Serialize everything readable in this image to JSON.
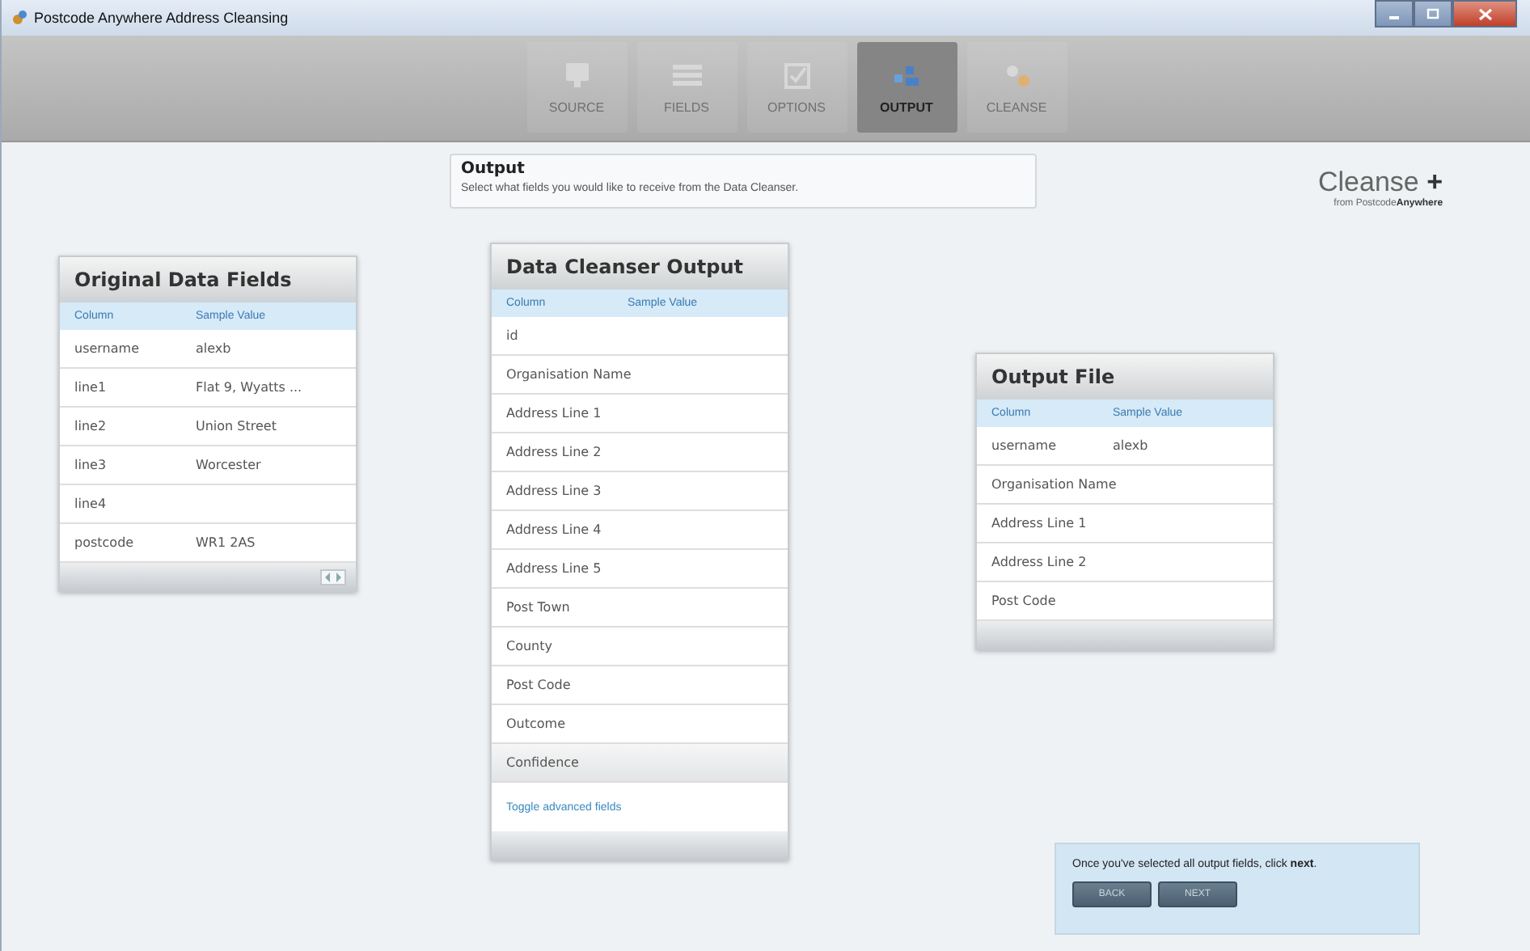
{
  "window": {
    "title": "Postcode Anywhere Address Cleansing"
  },
  "steps": [
    {
      "label": "SOURCE",
      "selected": false,
      "kind": "monitor"
    },
    {
      "label": "FIELDS",
      "selected": false,
      "kind": "list"
    },
    {
      "label": "OPTIONS",
      "selected": false,
      "kind": "check"
    },
    {
      "label": "OUTPUT",
      "selected": true,
      "kind": "output"
    },
    {
      "label": "CLEANSE",
      "selected": false,
      "kind": "gears"
    }
  ],
  "header": {
    "title": "Output",
    "description": "Select what fields you would like to receive from the Data Cleanser."
  },
  "logo": {
    "name": "Cleanse",
    "plus": "+",
    "tagline_prefix": "from Postcode",
    "tagline_brand": "Anywhere"
  },
  "original_fields": {
    "title": "Original Data Fields",
    "columns": [
      "Column",
      "Sample Value"
    ],
    "rows": [
      {
        "column": "username",
        "value": "alexb"
      },
      {
        "column": "line1",
        "value": "Flat 9, Wyatts ..."
      },
      {
        "column": "line2",
        "value": "Union Street"
      },
      {
        "column": "line3",
        "value": "Worcester"
      },
      {
        "column": "line4",
        "value": ""
      },
      {
        "column": "postcode",
        "value": "WR1 2AS"
      }
    ]
  },
  "cleanser_output": {
    "title": "Data Cleanser Output",
    "columns": [
      "Column",
      "Sample Value"
    ],
    "rows": [
      {
        "column": "id",
        "highlighted": false
      },
      {
        "column": "Organisation Name",
        "highlighted": false
      },
      {
        "column": "Address Line 1",
        "highlighted": false
      },
      {
        "column": "Address Line 2",
        "highlighted": false
      },
      {
        "column": "Address Line 3",
        "highlighted": false
      },
      {
        "column": "Address Line 4",
        "highlighted": false
      },
      {
        "column": "Address Line 5",
        "highlighted": false
      },
      {
        "column": "Post Town",
        "highlighted": false
      },
      {
        "column": "County",
        "highlighted": false
      },
      {
        "column": "Post Code",
        "highlighted": false
      },
      {
        "column": "Outcome",
        "highlighted": false
      },
      {
        "column": "Confidence",
        "highlighted": true
      }
    ],
    "link": "Toggle advanced fields"
  },
  "output_file": {
    "title": "Output File",
    "columns": [
      "Column",
      "Sample Value"
    ],
    "rows": [
      {
        "column": "username",
        "value": "alexb"
      },
      {
        "column": "Organisation Name",
        "value": ""
      },
      {
        "column": "Address Line 1",
        "value": ""
      },
      {
        "column": "Address Line 2",
        "value": ""
      },
      {
        "column": "Post Code",
        "value": ""
      }
    ]
  },
  "note": {
    "text": "Once you've selected all output fields, click **next**.",
    "buttons": [
      "BACK",
      "NEXT"
    ]
  }
}
